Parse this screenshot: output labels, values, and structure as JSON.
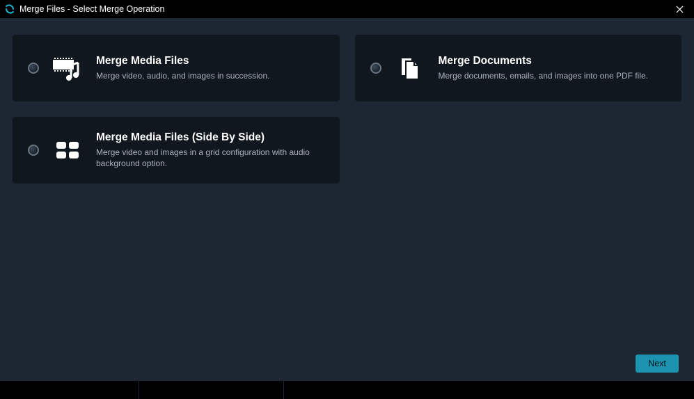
{
  "window": {
    "title": "Merge Files - Select Merge Operation"
  },
  "options": [
    {
      "id": "media",
      "title": "Merge Media Files",
      "description": "Merge video, audio, and images in succession."
    },
    {
      "id": "documents",
      "title": "Merge Documents",
      "description": "Merge documents, emails, and images into one PDF file."
    },
    {
      "id": "media-side-by-side",
      "title": "Merge Media Files (Side By Side)",
      "description": "Merge video and images in a grid configuration with audio background option."
    }
  ],
  "footer": {
    "next_label": "Next"
  }
}
